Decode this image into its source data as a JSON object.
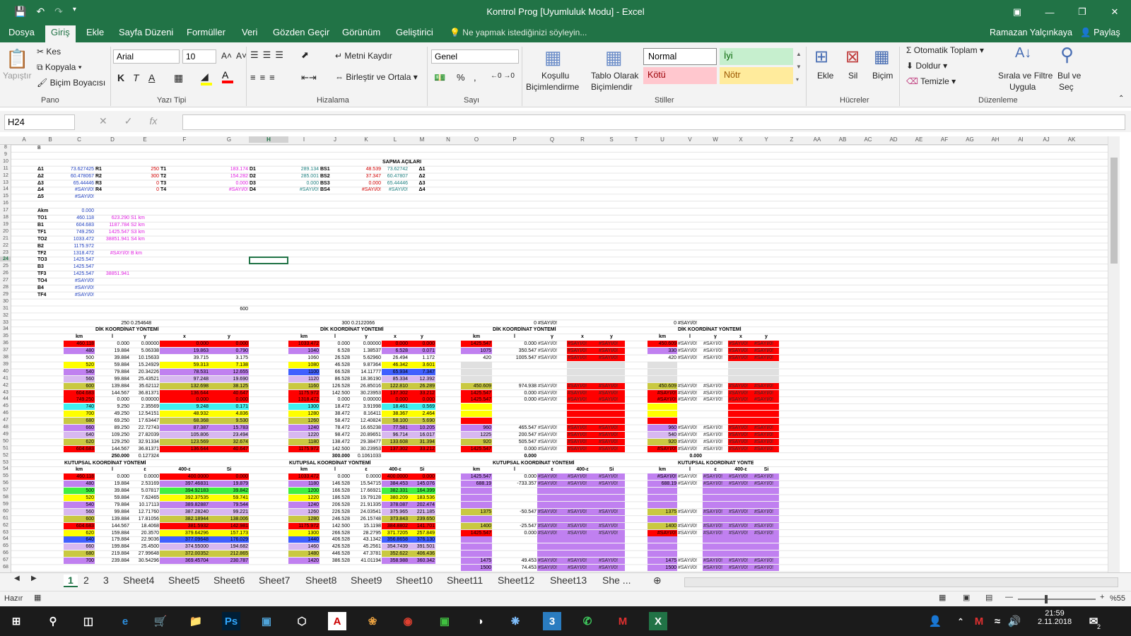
{
  "window": {
    "title": "Kontrol Prog  [Uyumluluk Modu] - Excel"
  },
  "menu": {
    "tabs": [
      "Dosya",
      "Giriş",
      "Ekle",
      "Sayfa Düzeni",
      "Formüller",
      "Veri",
      "Gözden Geçir",
      "Görünüm",
      "Geliştirici"
    ],
    "tell_me": "Ne yapmak istediğinizi söyleyin...",
    "user": "Ramazan Yalçınkaya",
    "share": "Paylaş"
  },
  "ribbon": {
    "paste": "Yapıştır",
    "cut": "Kes",
    "copy": "Kopyala",
    "format_painter": "Biçim Boyacısı",
    "font_name": "Arial",
    "font_size": "10",
    "bold": "K",
    "italic": "T",
    "underline": "A",
    "wrap_text": "Metni Kaydır",
    "merge_center": "Birleştir ve Ortala",
    "number_format": "Genel",
    "percent": "%",
    "cond_format_1": "Koşullu",
    "cond_format_2": "Biçimlendirme",
    "table_format_1": "Tablo Olarak",
    "table_format_2": "Biçimlendir",
    "styles": {
      "normal": "Normal",
      "good": "İyi",
      "bad": "Kötü",
      "neutral": "Nötr"
    },
    "insert": "Ekle",
    "delete": "Sil",
    "format": "Biçim",
    "autosum": "Otomatik Toplam",
    "fill": "Doldur",
    "clear": "Temizle",
    "sort_filter_1": "Sırala ve Filtre",
    "sort_filter_2": "Uygula",
    "find_select_1": "Bul ve",
    "find_select_2": "Seç",
    "groups": {
      "clipboard": "Pano",
      "font": "Yazı Tipi",
      "alignment": "Hizalama",
      "number": "Sayı",
      "styles": "Stiller",
      "cells": "Hücreler",
      "editing": "Düzenleme"
    }
  },
  "formula_bar": {
    "name_box": "H24",
    "fx": "fx",
    "value": ""
  },
  "grid": {
    "columns": [
      "A",
      "B",
      "C",
      "D",
      "E",
      "F",
      "G",
      "H",
      "I",
      "J",
      "K",
      "L",
      "M",
      "N",
      "O",
      "P",
      "Q",
      "R",
      "S",
      "T",
      "U",
      "V",
      "W",
      "X",
      "Y",
      "Z",
      "AA",
      "AB",
      "AC",
      "AD",
      "AE",
      "AF",
      "AG",
      "AH",
      "AI",
      "AJ",
      "AK"
    ],
    "rows": [
      "8",
      "9",
      "10",
      "11",
      "12",
      "13",
      "14",
      "15",
      "16",
      "17",
      "18",
      "19",
      "20",
      "21",
      "22",
      "23",
      "24",
      "25",
      "26",
      "27",
      "28",
      "29",
      "30",
      "31",
      "32",
      "33",
      "34",
      "35",
      "36",
      "37",
      "38",
      "39",
      "40",
      "41",
      "42",
      "43",
      "44",
      "45",
      "46",
      "47",
      "48",
      "49",
      "50",
      "51",
      "52",
      "53",
      "54",
      "55",
      "56",
      "57",
      "58",
      "59",
      "60",
      "61",
      "62",
      "63",
      "64",
      "65",
      "66",
      "67",
      "68"
    ],
    "selected_cell": "H24",
    "header_block": {
      "b8": "B",
      "sapma": "SAPMA AÇILARI",
      "rows": [
        [
          "Δ1",
          "73.627425",
          "R1",
          "250",
          "T1",
          "183.174",
          "D1",
          "289.134",
          "BS1",
          "48.539",
          "73.62742",
          "Δ1"
        ],
        [
          "Δ2",
          "60.478067",
          "R2",
          "300",
          "T2",
          "154.282",
          "D2",
          "285.001",
          "BS2",
          "37.347",
          "60.47807",
          "Δ2"
        ],
        [
          "Δ3",
          "65.44446",
          "R3",
          "0",
          "T3",
          "0.000",
          "D3",
          "0.000",
          "BS3",
          "0.000",
          "65.44446",
          "Δ3"
        ],
        [
          "Δ4",
          "#SAYI/0!",
          "R4",
          "0",
          "T4",
          "#SAYI/0!",
          "D4",
          "#SAYI/0!",
          "BS4",
          "#SAYI/0!",
          "#SAYI/0!",
          "Δ4"
        ],
        [
          "Δ5",
          "#SAYI/0!",
          "",
          "",
          "",
          "",
          "",
          "",
          "",
          "",
          "",
          ""
        ]
      ]
    },
    "km_list": [
      [
        "Akm",
        "0.000",
        "",
        ""
      ],
      [
        "TO1",
        "460.118",
        "623.290",
        "S1 km"
      ],
      [
        "B1",
        "604.683",
        "1187.784",
        "S2 km"
      ],
      [
        "TF1",
        "749.250",
        "1425.547",
        "S3 km"
      ],
      [
        "TO2",
        "1033.472",
        "38851.941",
        "S4 km"
      ],
      [
        "B2",
        "1175.972",
        "",
        ""
      ],
      [
        "TF2",
        "1318.472",
        "#SAYI/0!",
        "B km"
      ],
      [
        "TO3",
        "1425.547",
        "",
        ""
      ],
      [
        "B3",
        "1425.547",
        "",
        ""
      ],
      [
        "TF3",
        "1425.547",
        "38851.941",
        ""
      ],
      [
        "TO4",
        "#SAYI/0!",
        "",
        ""
      ],
      [
        "B4",
        "#SAYI/0!",
        "",
        ""
      ],
      [
        "TF4",
        "#SAYI/0!",
        "",
        ""
      ]
    ],
    "g31": "600",
    "block_titles": {
      "dik": "DİK KOORDİNAT YÖNTEMİ",
      "kutupsal": "KUTUPSAL KOORDİNAT YÖNTEMİ"
    },
    "block1_top": {
      "pre": [
        "250",
        "0.254648"
      ],
      "headers": [
        "km",
        "l",
        "γ",
        "x",
        "y"
      ],
      "rows": [
        [
          "460.118",
          "0.000",
          "0.00000",
          "0.000",
          "0.000"
        ],
        [
          "480",
          "19.884",
          "5.06338",
          "19.863",
          "0.790"
        ],
        [
          "500",
          "39.884",
          "10.15633",
          "39.715",
          "3.175"
        ],
        [
          "520",
          "59.884",
          "15.24929",
          "59.313",
          "7.138"
        ],
        [
          "540",
          "79.884",
          "20.34226",
          "78.531",
          "12.655"
        ],
        [
          "560",
          "99.884",
          "25.43521",
          "97.248",
          "19.690"
        ],
        [
          "600",
          "139.884",
          "35.62112",
          "132.698",
          "38.125"
        ],
        [
          "604.683",
          "144.567",
          "36.81371",
          "136.644",
          "40.647"
        ],
        [
          "749.250",
          "0.000",
          "0.00000",
          "0.000",
          "0.000"
        ],
        [
          "740",
          "9.250",
          "2.35569",
          "9.248",
          "0.171"
        ],
        [
          "700",
          "49.250",
          "12.54151",
          "48.932",
          "4.836"
        ],
        [
          "680",
          "69.250",
          "17.63447",
          "68.368",
          "9.530"
        ],
        [
          "660",
          "89.250",
          "22.72743",
          "87.387",
          "15.783"
        ],
        [
          "640",
          "109.250",
          "27.82039",
          "105.806",
          "23.494"
        ],
        [
          "620",
          "129.250",
          "32.91334",
          "123.569",
          "32.674"
        ],
        [
          "604.683",
          "144.567",
          "36.81371",
          "136.644",
          "40.647"
        ]
      ],
      "footer": [
        "250.000",
        "0.127324"
      ]
    },
    "block2_top": {
      "pre": [
        "300",
        "0.2122066"
      ],
      "headers": [
        "km",
        "l",
        "γ",
        "x",
        "y"
      ],
      "rows": [
        [
          "1033.472",
          "0.000",
          "0.00000",
          "0.000",
          "0.000"
        ],
        [
          "1040",
          "6.528",
          "1.38537",
          "6.528",
          "0.071"
        ],
        [
          "1060",
          "26.528",
          "5.62960",
          "26.494",
          "1.172"
        ],
        [
          "1080",
          "46.528",
          "9.87364",
          "46.342",
          "3.601"
        ],
        [
          "1100",
          "66.528",
          "14.11777",
          "65.934",
          "7.347"
        ],
        [
          "1120",
          "86.528",
          "18.36190",
          "85.334",
          "12.392"
        ],
        [
          "1160",
          "126.528",
          "26.85016",
          "122.810",
          "26.289"
        ],
        [
          "1175.972",
          "142.500",
          "30.23953",
          "137.302",
          "33.212"
        ],
        [
          "1318.472",
          "0.000",
          "0.00000",
          "0.000",
          "0.000"
        ],
        [
          "1300",
          "18.472",
          "3.91998",
          "18.461",
          "0.569"
        ],
        [
          "1280",
          "38.472",
          "8.16411",
          "38.367",
          "2.464"
        ],
        [
          "1260",
          "58.472",
          "12.40824",
          "58.100",
          "5.690"
        ],
        [
          "1240",
          "78.472",
          "16.65238",
          "77.581",
          "10.205"
        ],
        [
          "1220",
          "98.472",
          "20.89651",
          "96.714",
          "16.017"
        ],
        [
          "1180",
          "138.472",
          "29.38477",
          "133.608",
          "31.394"
        ],
        [
          "1175.972",
          "142.500",
          "30.23953",
          "137.302",
          "33.212"
        ]
      ],
      "footer": [
        "300.000",
        "0.1061033"
      ]
    },
    "block1_bottom": {
      "headers": [
        "km",
        "l",
        "ε",
        "400-ε",
        "Si"
      ],
      "rows": [
        [
          "460.118",
          "0.000",
          "0.0000",
          "400.0000",
          "0.000"
        ],
        [
          "480",
          "19.884",
          "2.53169",
          "397.46831",
          "19.879"
        ],
        [
          "500",
          "39.884",
          "5.07817",
          "394.92183",
          "39.842"
        ],
        [
          "520",
          "59.884",
          "7.62465",
          "392.37535",
          "59.741"
        ],
        [
          "540",
          "79.884",
          "10.17113",
          "389.82887",
          "79.544"
        ],
        [
          "560",
          "99.884",
          "12.71760",
          "387.28240",
          "99.221"
        ],
        [
          "600",
          "139.884",
          "17.81056",
          "382.18944",
          "138.006"
        ],
        [
          "604.683",
          "144.567",
          "18.4068",
          "381.5932",
          "142.981"
        ],
        [
          "620",
          "159.884",
          "20.3570",
          "379.64296",
          "157.173"
        ],
        [
          "640",
          "179.884",
          "22.9036",
          "377.09648",
          "176.029"
        ],
        [
          "660",
          "199.884",
          "25.4500",
          "374.55000",
          "194.682"
        ],
        [
          "680",
          "219.884",
          "27.99648",
          "372.00352",
          "212.865"
        ],
        [
          "700",
          "239.884",
          "30.54296",
          "369.45704",
          "230.787"
        ]
      ]
    },
    "block2_bottom": {
      "headers": [
        "km",
        "l",
        "ε",
        "400-ε",
        "Si"
      ],
      "rows": [
        [
          "1033.472",
          "0.000",
          "0.0000",
          "400.0000",
          "0.000"
        ],
        [
          "1180",
          "146.528",
          "15.54715",
          "384.453",
          "145.076"
        ],
        [
          "1200",
          "166.528",
          "17.66921",
          "382.331",
          "164.399"
        ],
        [
          "1220",
          "186.528",
          "19.79128",
          "380.209",
          "183.536"
        ],
        [
          "1240",
          "206.528",
          "21.91335",
          "378.087",
          "202.474"
        ],
        [
          "1260",
          "226.528",
          "24.03541",
          "375.965",
          "221.185"
        ],
        [
          "1280",
          "246.528",
          "26.15748",
          "373.843",
          "239.650"
        ],
        [
          "1175.972",
          "142.500",
          "15.1198",
          "384.8802",
          "141.701"
        ],
        [
          "1300",
          "266.528",
          "28.2795",
          "371.7205",
          "257.849"
        ],
        [
          "1440",
          "406.528",
          "43.1342",
          "356.8658",
          "376.130"
        ],
        [
          "1460",
          "426.528",
          "45.2561",
          "354.7439",
          "391.501"
        ],
        [
          "1480",
          "446.528",
          "47.3781",
          "352.622",
          "406.436"
        ],
        [
          "1420",
          "386.528",
          "41.01194",
          "358.988",
          "360.342"
        ]
      ]
    },
    "block3": {
      "pre": [
        "0",
        "#SAYI/0!"
      ],
      "headers": [
        "km",
        "l",
        "γ",
        "x",
        "y"
      ],
      "kms": [
        "1425.547",
        "1075",
        "420",
        "",
        "",
        "",
        "450.609",
        "1425.547",
        "1425.547",
        "",
        "",
        "",
        "960",
        "1225",
        "920",
        "1425.547"
      ],
      "ls": [
        "0.000",
        "350.547",
        "1005.547",
        "",
        "",
        "",
        "974.938",
        "0.000",
        "0.000",
        "",
        "",
        "",
        "465.547",
        "200.547",
        "505.547",
        "0.000"
      ],
      "err": "#SAYI/0!",
      "footer": "0.000",
      "bottom_headers": [
        "km",
        "l",
        "ε",
        "400-ε",
        "Si"
      ],
      "bottom_kms": [
        "1425.547",
        "688.19",
        "",
        "",
        "",
        "1375",
        "",
        "1400",
        "1425.547",
        "",
        "",
        "",
        "1475",
        "1500"
      ],
      "bottom_ls": [
        "0.000",
        "-733.357",
        "",
        "",
        "",
        "-50.547",
        "",
        "-25.547",
        "0.000",
        "",
        "",
        "",
        "49.453",
        "74.453"
      ]
    },
    "block4": {
      "pre": [
        "0",
        "#SAYI/0!"
      ],
      "headers": [
        "km",
        "l",
        "γ",
        "x",
        "y"
      ],
      "kms": [
        "450.609",
        "330",
        "420",
        "",
        "",
        "",
        "450.609",
        "#SAYI/0!",
        "#SAYI/0!",
        "",
        "",
        "",
        "960",
        "540",
        "920",
        "#SAYI/0!"
      ],
      "err": "#SAYI/0!",
      "footer": "0.000",
      "bottom_headers": [
        "km",
        "l",
        "ε",
        "400-ε",
        "Si"
      ],
      "bottom_kms": [
        "#SAYI/0!",
        "688.19",
        "",
        "",
        "",
        "1375",
        "",
        "1400",
        "#SAYI/0!",
        "",
        "",
        "",
        "1475",
        "1500"
      ]
    }
  },
  "sheets": {
    "tabs": [
      "1",
      "2",
      "3",
      "Sheet4",
      "Sheet5",
      "Sheet6",
      "Sheet7",
      "Sheet8",
      "Sheet9",
      "Sheet10",
      "Sheet11",
      "Sheet12",
      "Sheet13",
      "She ..."
    ],
    "active": "1"
  },
  "status": {
    "ready": "Hazır",
    "zoom": "%55"
  },
  "taskbar": {
    "time": "21:59",
    "date": "2.11.2018",
    "notif": "2"
  }
}
